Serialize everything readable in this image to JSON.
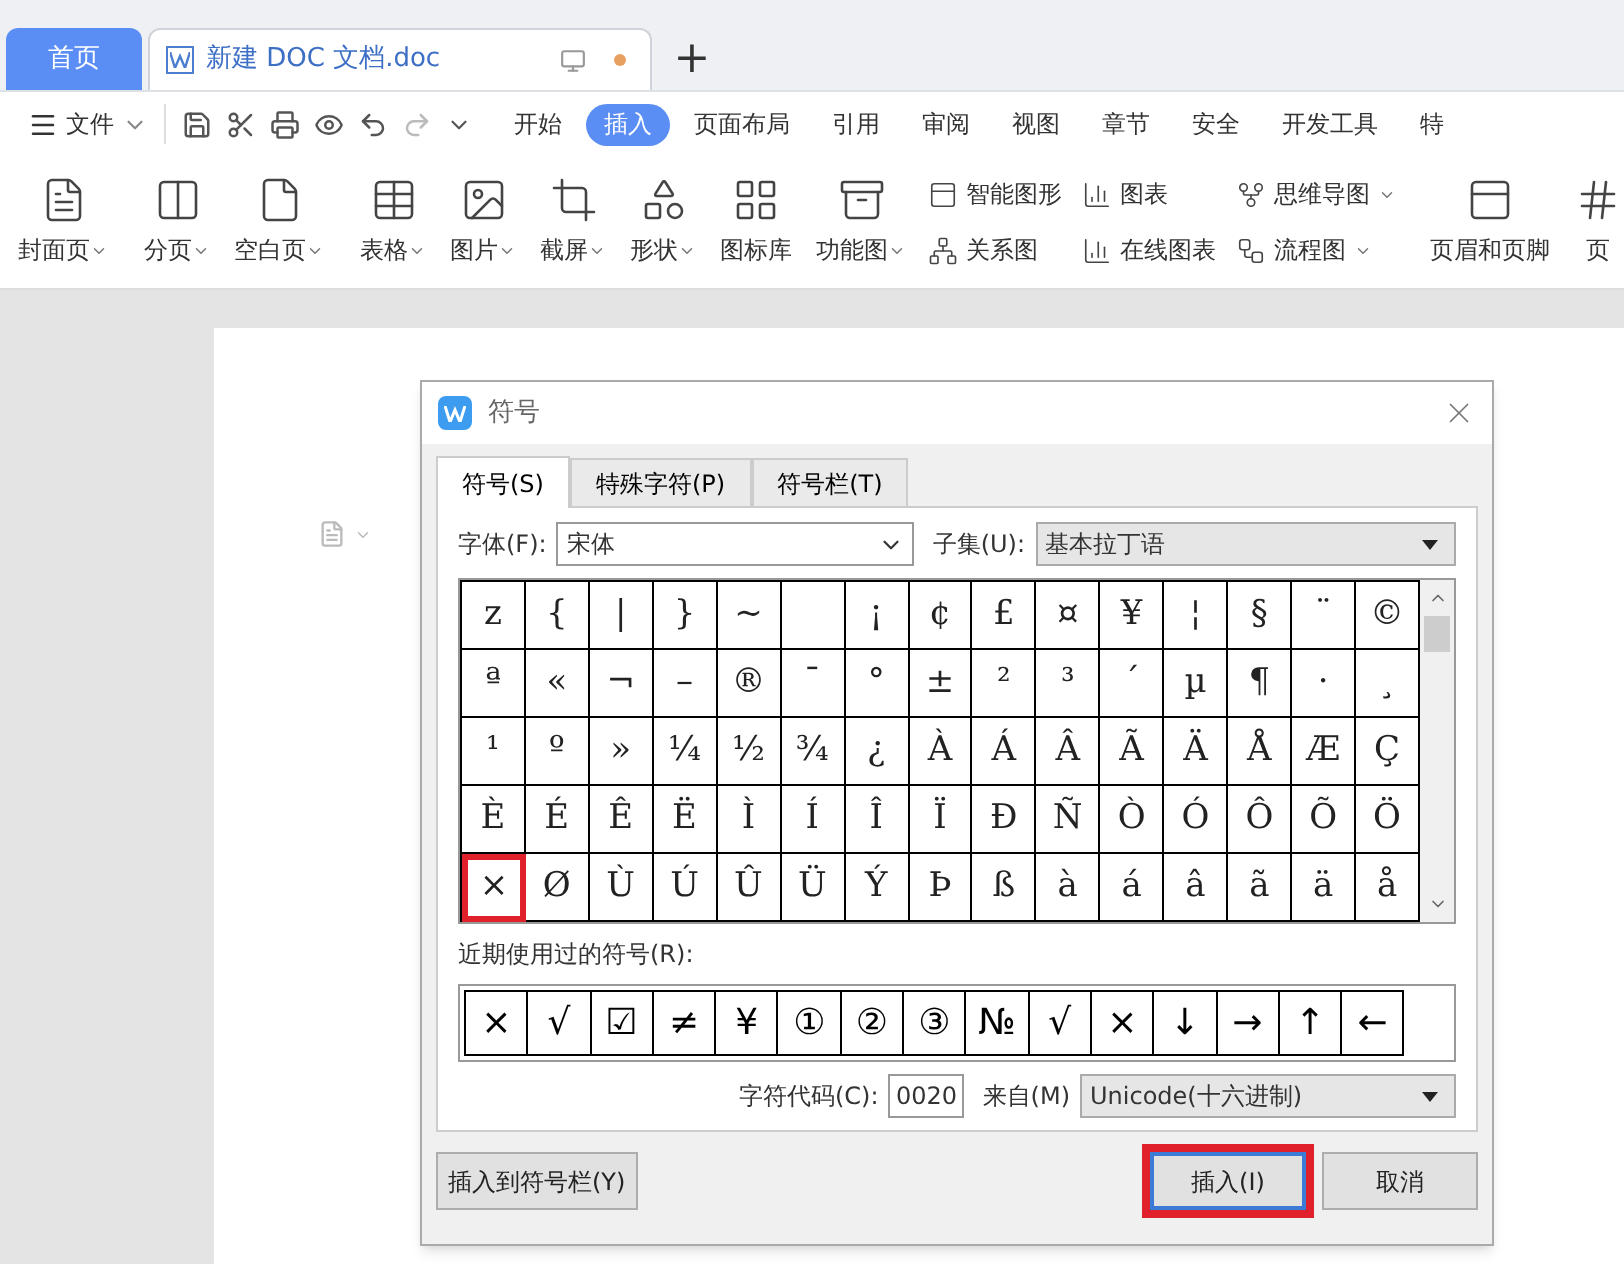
{
  "app_tabs": [
    {
      "label": "首页",
      "kind": "home",
      "selected": false
    },
    {
      "label": "新建 DOC 文档.doc",
      "kind": "document",
      "selected": true,
      "unsaved": true
    }
  ],
  "new_tab": "+",
  "menu": {
    "file": "文件",
    "tabs": [
      {
        "label": "开始",
        "selected": false
      },
      {
        "label": "插入",
        "selected": true
      },
      {
        "label": "页面布局",
        "selected": false
      },
      {
        "label": "引用",
        "selected": false
      },
      {
        "label": "审阅",
        "selected": false
      },
      {
        "label": "视图",
        "selected": false
      },
      {
        "label": "章节",
        "selected": false
      },
      {
        "label": "安全",
        "selected": false
      },
      {
        "label": "开发工具",
        "selected": false
      },
      {
        "label": "特",
        "selected": false
      }
    ]
  },
  "ribbon": [
    [
      {
        "kind": "large",
        "label": "封面页",
        "dropdown": true
      }
    ],
    [
      {
        "kind": "large",
        "label": "分页",
        "dropdown": true
      },
      {
        "kind": "large",
        "label": "空白页",
        "dropdown": true
      }
    ],
    [
      {
        "kind": "large",
        "label": "表格",
        "dropdown": true
      },
      {
        "kind": "large",
        "label": "图片",
        "dropdown": true
      },
      {
        "kind": "large",
        "label": "截屏",
        "dropdown": true
      },
      {
        "kind": "large",
        "label": "形状",
        "dropdown": true
      },
      {
        "kind": "large",
        "label": "图标库",
        "dropdown": false
      },
      {
        "kind": "large",
        "label": "功能图",
        "dropdown": true
      },
      {
        "kind": "stack",
        "items": [
          {
            "label": "智能图形",
            "dropdown": false
          },
          {
            "label": "关系图",
            "dropdown": false
          }
        ]
      },
      {
        "kind": "stack",
        "items": [
          {
            "label": "图表",
            "dropdown": false
          },
          {
            "label": "在线图表",
            "dropdown": false
          }
        ]
      },
      {
        "kind": "stack",
        "items": [
          {
            "label": "思维导图",
            "dropdown": true
          },
          {
            "label": "流程图",
            "dropdown": true
          }
        ]
      }
    ],
    [
      {
        "kind": "large",
        "label": "页眉和页脚",
        "dropdown": false
      },
      {
        "kind": "large",
        "label": "页",
        "dropdown": false
      }
    ]
  ],
  "dialog": {
    "title": "符号",
    "tabs": [
      {
        "label": "符号(S)",
        "selected": true
      },
      {
        "label": "特殊字符(P)",
        "selected": false
      },
      {
        "label": "符号栏(T)",
        "selected": false
      }
    ],
    "font_label": "字体(F):",
    "font_value": "宋体",
    "subset_label": "子集(U):",
    "subset_value": "基本拉丁语",
    "symbols": [
      [
        {
          "char": "z",
          "selected": false
        },
        {
          "char": "{",
          "selected": false
        },
        {
          "char": "|",
          "selected": false
        },
        {
          "char": "}",
          "selected": false
        },
        {
          "char": "~",
          "selected": false
        },
        {
          "selected": false
        },
        {
          "char": "¡",
          "selected": false
        },
        {
          "char": "¢",
          "selected": false
        },
        {
          "char": "£",
          "selected": false
        },
        {
          "char": "¤",
          "selected": false
        },
        {
          "char": "¥",
          "selected": false
        },
        {
          "char": "¦",
          "selected": false
        },
        {
          "char": "§",
          "selected": false
        },
        {
          "char": "¨",
          "selected": false
        },
        {
          "char": "©",
          "selected": false
        }
      ],
      [
        {
          "char": "ª",
          "selected": false
        },
        {
          "char": "«",
          "selected": false
        },
        {
          "char": "¬",
          "selected": false
        },
        {
          "char": "–",
          "selected": false
        },
        {
          "char": "®",
          "selected": false
        },
        {
          "char": "¯",
          "selected": false
        },
        {
          "char": "°",
          "selected": false
        },
        {
          "char": "±",
          "selected": false
        },
        {
          "char": "²",
          "selected": false
        },
        {
          "char": "³",
          "selected": false
        },
        {
          "char": "´",
          "selected": false
        },
        {
          "char": "µ",
          "selected": false
        },
        {
          "char": "¶",
          "selected": false
        },
        {
          "char": "·",
          "selected": false
        },
        {
          "char": "¸",
          "selected": false
        }
      ],
      [
        {
          "char": "¹",
          "selected": false
        },
        {
          "char": "º",
          "selected": false
        },
        {
          "char": "»",
          "selected": false
        },
        {
          "char": "¼",
          "selected": false
        },
        {
          "char": "½",
          "selected": false
        },
        {
          "char": "¾",
          "selected": false
        },
        {
          "char": "¿",
          "selected": false
        },
        {
          "char": "À",
          "selected": false
        },
        {
          "char": "Á",
          "selected": false
        },
        {
          "char": "Â",
          "selected": false
        },
        {
          "char": "Ã",
          "selected": false
        },
        {
          "char": "Ä",
          "selected": false
        },
        {
          "char": "Å",
          "selected": false
        },
        {
          "char": "Æ",
          "selected": false
        },
        {
          "char": "Ç",
          "selected": false
        }
      ],
      [
        {
          "char": "È",
          "selected": false
        },
        {
          "char": "É",
          "selected": false
        },
        {
          "char": "Ê",
          "selected": false
        },
        {
          "char": "Ë",
          "selected": false
        },
        {
          "char": "Ì",
          "selected": false
        },
        {
          "char": "Í",
          "selected": false
        },
        {
          "char": "Î",
          "selected": false
        },
        {
          "char": "Ï",
          "selected": false
        },
        {
          "char": "Ð",
          "selected": false
        },
        {
          "char": "Ñ",
          "selected": false
        },
        {
          "char": "Ò",
          "selected": false
        },
        {
          "char": "Ó",
          "selected": false
        },
        {
          "char": "Ô",
          "selected": false
        },
        {
          "char": "Õ",
          "selected": false
        },
        {
          "char": "Ö",
          "selected": false
        }
      ],
      [
        {
          "char": "×",
          "selected": true
        },
        {
          "char": "Ø",
          "selected": false
        },
        {
          "char": "Ù",
          "selected": false
        },
        {
          "char": "Ú",
          "selected": false
        },
        {
          "char": "Û",
          "selected": false
        },
        {
          "char": "Ü",
          "selected": false
        },
        {
          "char": "Ý",
          "selected": false
        },
        {
          "char": "Þ",
          "selected": false
        },
        {
          "char": "ß",
          "selected": false
        },
        {
          "char": "à",
          "selected": false
        },
        {
          "char": "á",
          "selected": false
        },
        {
          "char": "â",
          "selected": false
        },
        {
          "char": "ã",
          "selected": false
        },
        {
          "char": "ä",
          "selected": false
        },
        {
          "char": "å",
          "selected": false
        }
      ]
    ],
    "recent_label": "近期使用过的符号(R):",
    "recent": [
      "×",
      "√",
      "☑",
      "≠",
      "¥",
      "①",
      "②",
      "③",
      "№",
      "√",
      "×",
      "↓",
      "→",
      "↑",
      "←"
    ],
    "code_label": "字符代码(C):",
    "code_value": "0020",
    "from_label": "来自(M)",
    "from_value": "Unicode(十六进制)",
    "buttons": [
      {
        "label": "插入到符号栏(Y)",
        "kind": "secondary",
        "highlighted": false
      },
      {
        "label": "插入(I)",
        "kind": "primary",
        "highlighted": true
      },
      {
        "label": "取消",
        "kind": "secondary",
        "highlighted": false
      }
    ]
  }
}
